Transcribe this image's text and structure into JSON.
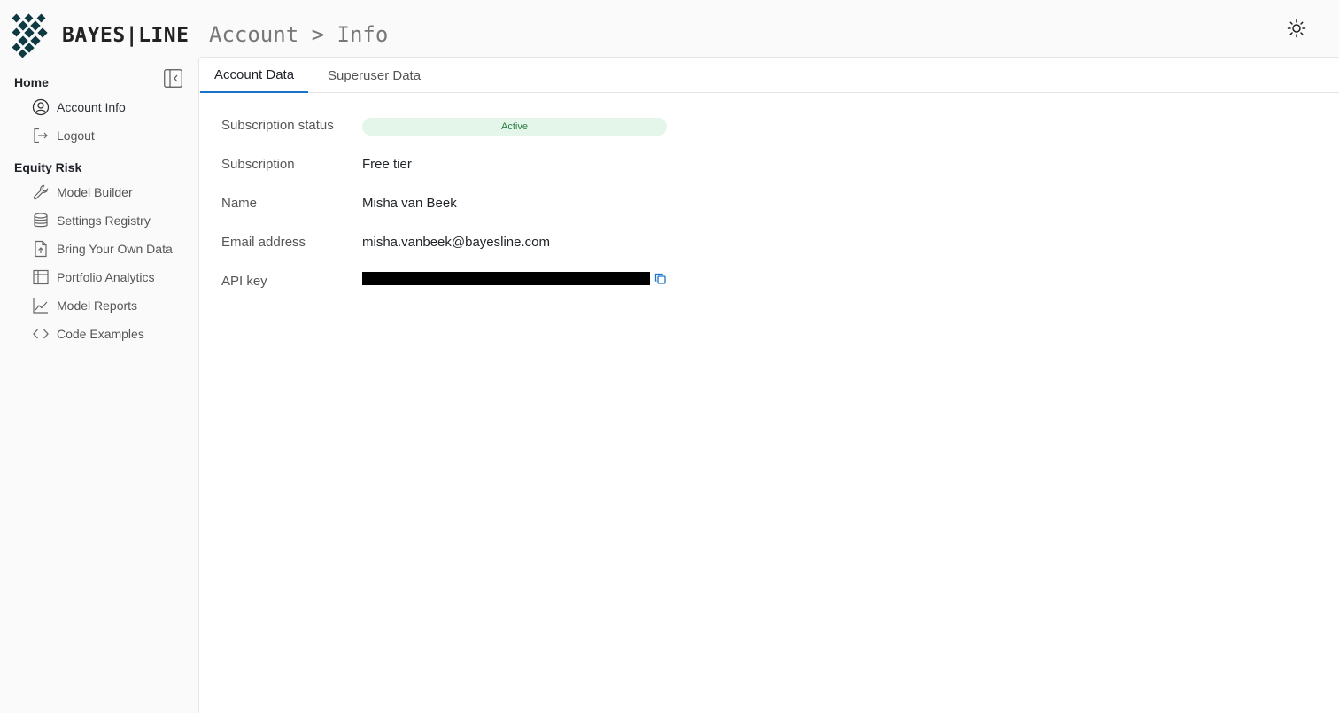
{
  "header": {
    "brand": "BAYES|LINE",
    "breadcrumb": "Account > Info",
    "theme_icon": "sun-icon"
  },
  "sidebar": {
    "sections": [
      {
        "title": "Home",
        "items": [
          {
            "label": "Account Info",
            "icon": "user-circle-icon",
            "active": true
          },
          {
            "label": "Logout",
            "icon": "logout-icon"
          }
        ]
      },
      {
        "title": "Equity Risk",
        "items": [
          {
            "label": "Model Builder",
            "icon": "wrench-icon"
          },
          {
            "label": "Settings Registry",
            "icon": "database-icon"
          },
          {
            "label": "Bring Your Own Data",
            "icon": "file-upload-icon"
          },
          {
            "label": "Portfolio Analytics",
            "icon": "table-icon"
          },
          {
            "label": "Model Reports",
            "icon": "line-chart-icon"
          },
          {
            "label": "Code Examples",
            "icon": "code-icon"
          }
        ]
      }
    ]
  },
  "tabs": [
    {
      "label": "Account Data",
      "active": true
    },
    {
      "label": "Superuser Data",
      "active": false
    }
  ],
  "account": {
    "status_label": "Subscription status",
    "status_value": "Active",
    "subscription_label": "Subscription",
    "subscription_value": "Free tier",
    "name_label": "Name",
    "name_value": "Misha van Beek",
    "email_label": "Email address",
    "email_value": "misha.vanbeek@bayesline.com",
    "api_key_label": "API key"
  },
  "colors": {
    "accent": "#1a73c8",
    "status_bg": "#e4f6e9",
    "status_text": "#2d7a44",
    "logo": "#0f3a44"
  }
}
